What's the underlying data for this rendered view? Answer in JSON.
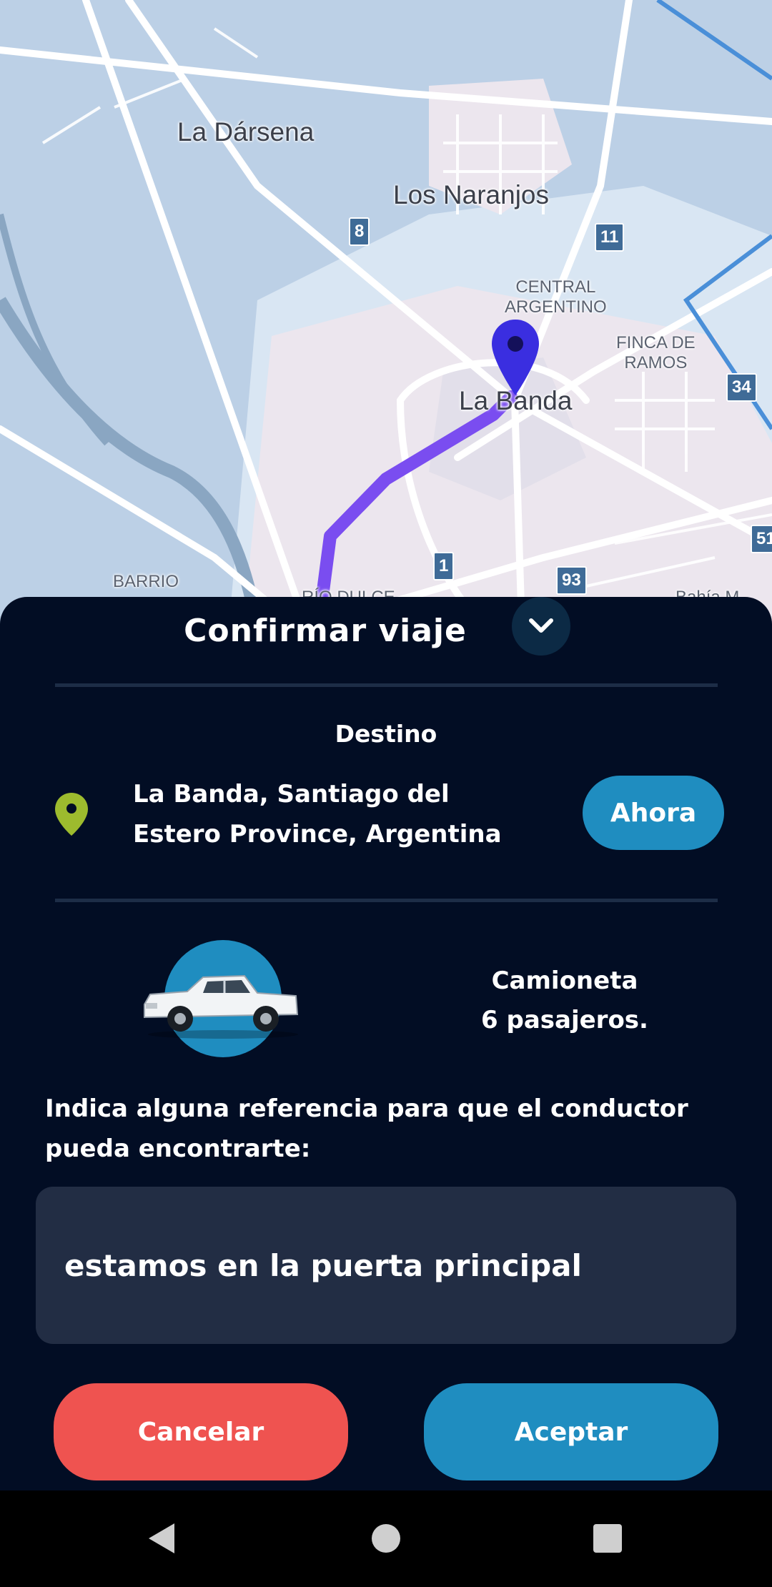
{
  "map": {
    "places": {
      "la_darsena": "La Dársena",
      "los_naranjos": "Los Naranjos",
      "la_banda": "La Banda",
      "central_argentino": "CENTRAL\nARGENTINO",
      "finca_de_ramos": "FINCA DE\nRAMOS",
      "barrio": "BARRIO",
      "rio_dulce": "RÍO DULCE",
      "bahia": "Bahía M"
    },
    "shields": [
      "8",
      "11",
      "34",
      "1",
      "93",
      "51"
    ],
    "pin_icon": "location-pin-icon",
    "route_color": "#7a4df0",
    "pin_color": "#3a2ee0"
  },
  "sheet": {
    "title": "Confirmar viaje",
    "collapse_icon": "chevron-down-icon",
    "destination_label": "Destino",
    "destination_address": "La Banda, Santiago del Estero Province, Argentina",
    "destination_icon": "map-marker-icon",
    "time_button": "Ahora",
    "vehicle": {
      "type": "Camioneta",
      "capacity": "6 pasajeros.",
      "image": "pickup-truck-image"
    },
    "reference_prompt": "Indica alguna referencia para que el conductor pueda encontrarte:",
    "reference_value": "estamos en la puerta principal",
    "cancel_button": "Cancelar",
    "accept_button": "Aceptar"
  },
  "colors": {
    "background": "#020d24",
    "accent": "#1f8dc0",
    "cancel": "#ef5350",
    "marker": "#9dbb2e"
  },
  "navbar": {
    "back_icon": "back-triangle-icon",
    "home_icon": "home-circle-icon",
    "recents_icon": "recents-square-icon"
  }
}
